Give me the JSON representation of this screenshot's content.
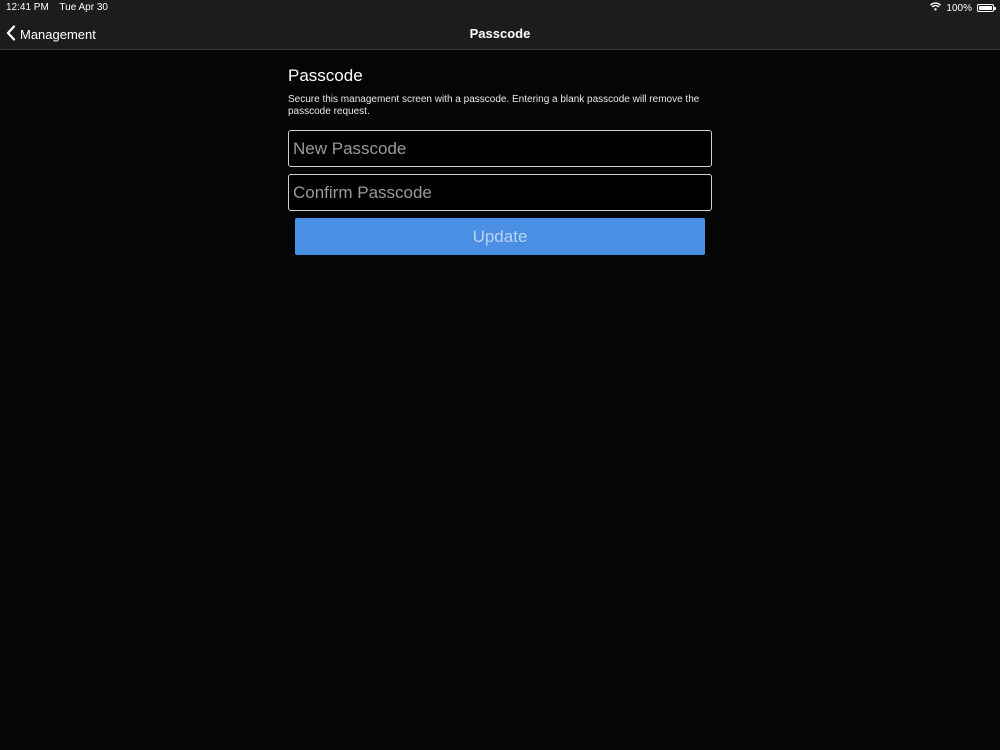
{
  "status_bar": {
    "time": "12:41 PM",
    "date": "Tue Apr 30",
    "battery": "100%",
    "icons": [
      "wifi-icon",
      "battery-icon"
    ]
  },
  "nav": {
    "back_label": "Management",
    "title": "Passcode"
  },
  "section": {
    "title": "Passcode",
    "description": "Secure this management screen with a passcode. Entering a blank passcode will remove the passcode request."
  },
  "form": {
    "new_passcode": {
      "value": "",
      "placeholder": "New Passcode"
    },
    "confirm_passcode": {
      "value": "",
      "placeholder": "Confirm Passcode"
    },
    "update_label": "Update"
  },
  "colors": {
    "background": "#050505",
    "bar_background": "#1c1c1e",
    "accent": "#4a8fe3"
  }
}
